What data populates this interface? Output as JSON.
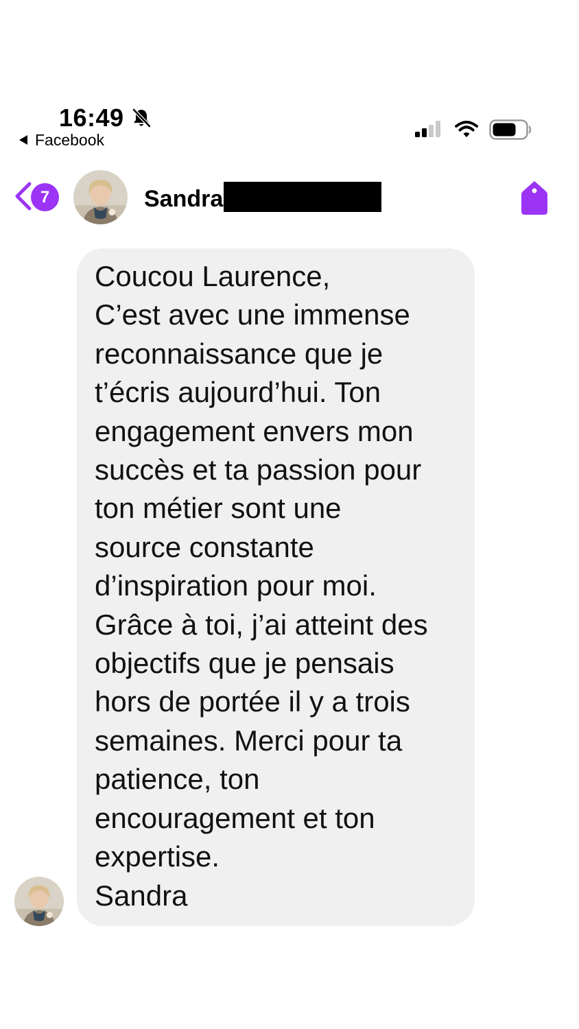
{
  "status_bar": {
    "time": "16:49",
    "back_app": "Facebook",
    "icons": [
      "bell-slash-icon",
      "cellular-signal-icon",
      "wifi-icon",
      "battery-icon"
    ]
  },
  "header": {
    "unread_count": "7",
    "contact_name": "Sandra",
    "icons": [
      "chevron-left-icon",
      "tag-icon"
    ]
  },
  "message": {
    "lines": [
      "Coucou Laurence,",
      "C’est avec une immense",
      "reconnaissance que je",
      "t’écris aujourd’hui. Ton",
      "engagement envers mon",
      "succès et ta passion pour",
      "ton métier sont une",
      "source constante",
      "d’inspiration pour moi.",
      "Grâce à toi, j’ai atteint des",
      "objectifs que je pensais",
      "hors de portée il y a trois",
      "semaines. Merci pour ta",
      "patience, ton",
      "encouragement et ton",
      "expertise.",
      "Sandra"
    ]
  },
  "colors": {
    "accent": "#9b34f5",
    "bubble": "#f0f0f0",
    "text": "#000000",
    "background": "#ffffff"
  }
}
